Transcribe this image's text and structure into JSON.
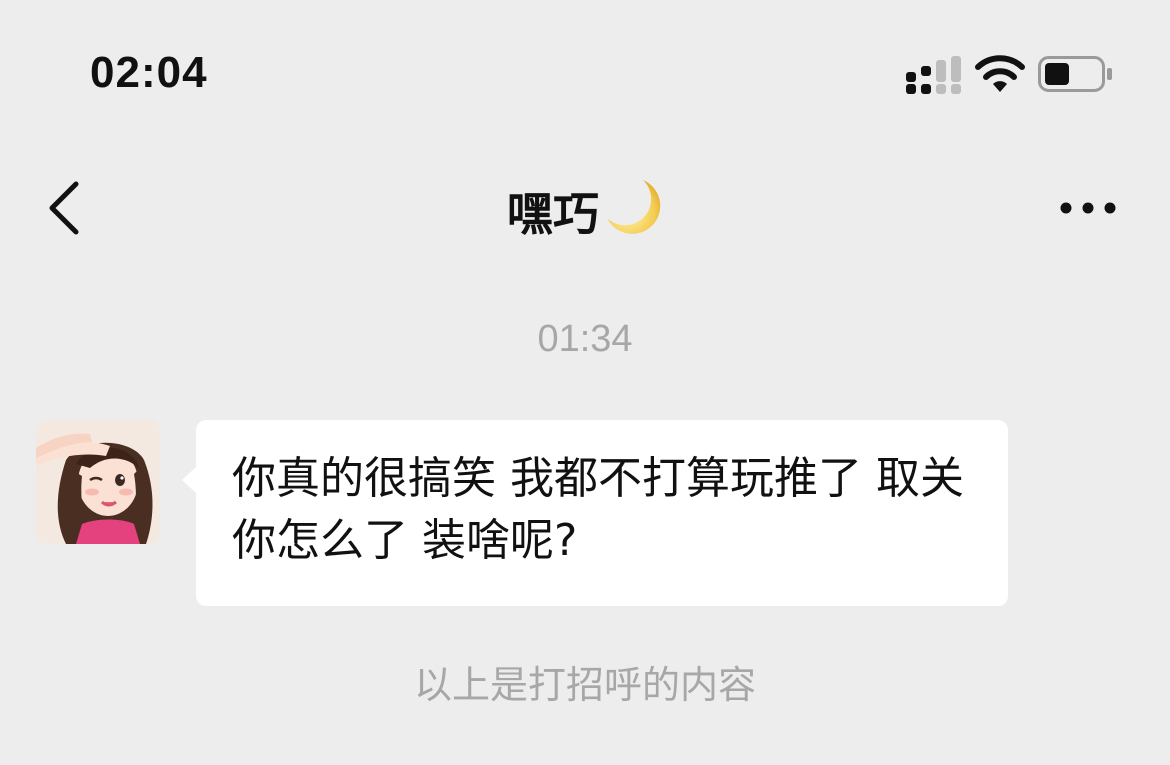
{
  "status_bar": {
    "time": "02:04",
    "icons": [
      "signal-icon",
      "wifi-icon",
      "battery-icon"
    ]
  },
  "nav": {
    "title": "嘿巧",
    "title_emoji": "moon-icon",
    "back_icon": "chevron-left-icon",
    "more_icon": "more-dots-icon"
  },
  "chat": {
    "timestamp": "01:34",
    "messages": [
      {
        "sender": "other",
        "avatar": "avatar",
        "text": "你真的很搞笑 我都不打算玩推了 取关你怎么了 装啥呢?"
      }
    ],
    "system_note": "以上是打招呼的内容"
  },
  "colors": {
    "background": "#ededed",
    "bubble": "#ffffff",
    "muted_text": "#a7a7a7",
    "text": "#111111"
  }
}
